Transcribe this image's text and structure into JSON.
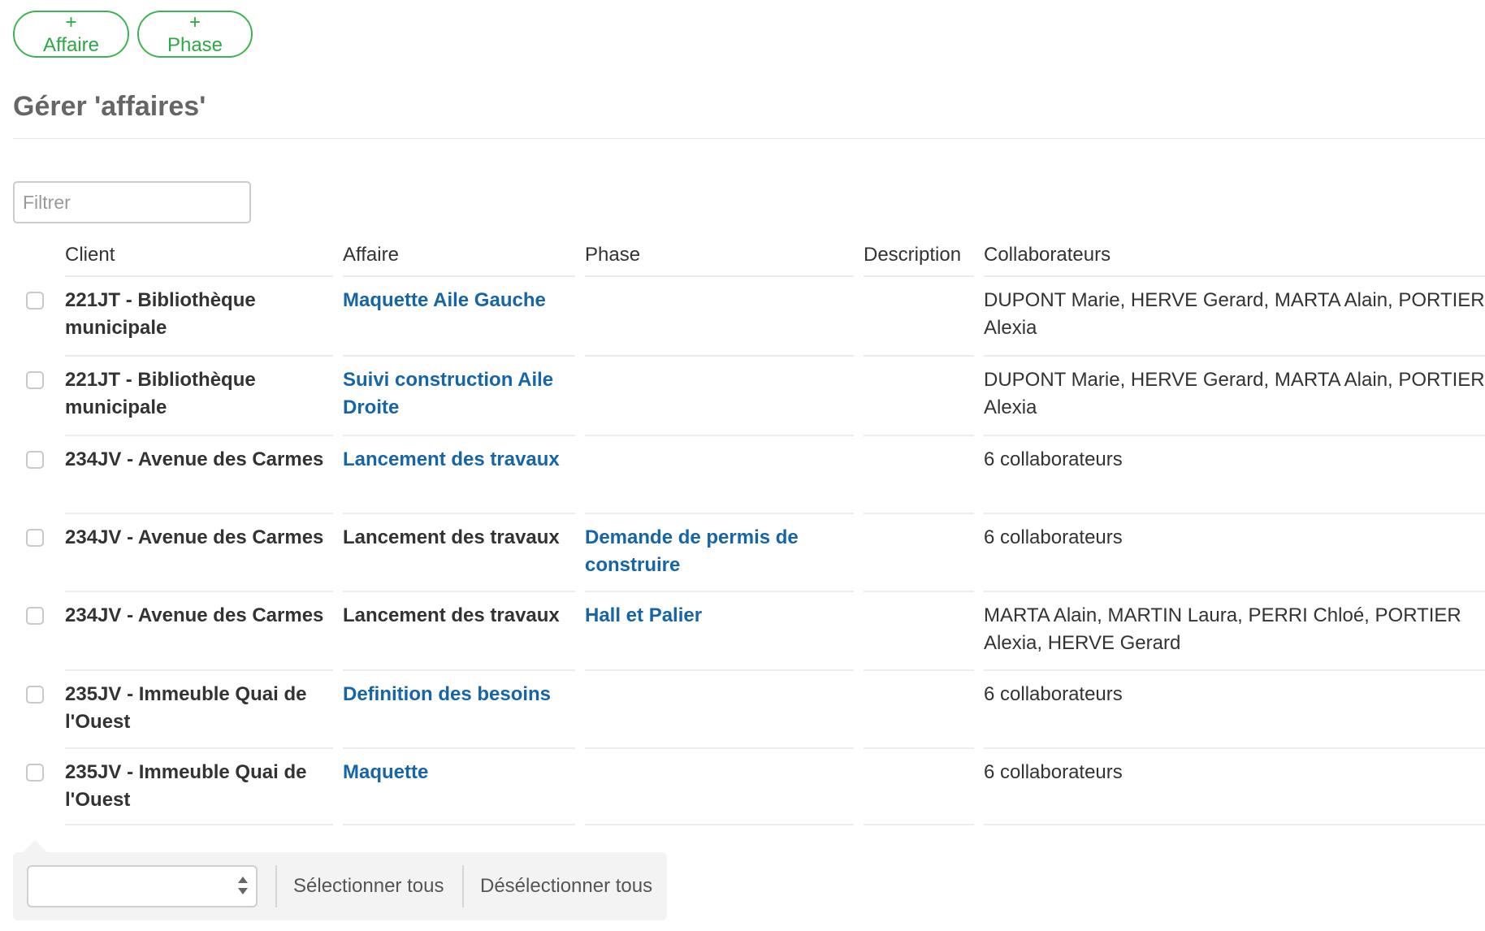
{
  "toolbar": {
    "add_affaire_label": "+ Affaire",
    "add_phase_label": "+ Phase"
  },
  "page": {
    "title": "Gérer 'affaires'"
  },
  "filter": {
    "placeholder": "Filtrer",
    "value": ""
  },
  "table": {
    "headers": {
      "client": "Client",
      "affaire": "Affaire",
      "phase": "Phase",
      "description": "Description",
      "collaborateurs": "Collaborateurs"
    },
    "rows": [
      {
        "client": "221JT - Bibliothèque municipale",
        "affaire": "Maquette Aile Gauche",
        "affaire_is_link": true,
        "phase": "",
        "description": "",
        "collaborateurs": "DUPONT Marie, HERVE Gerard, MARTA Alain, PORTIER Alexia"
      },
      {
        "client": "221JT - Bibliothèque municipale",
        "affaire": "Suivi construction Aile Droite",
        "affaire_is_link": true,
        "phase": "",
        "description": "",
        "collaborateurs": "DUPONT Marie, HERVE Gerard, MARTA Alain, PORTIER Alexia"
      },
      {
        "client": "234JV - Avenue des Carmes",
        "affaire": "Lancement des travaux",
        "affaire_is_link": true,
        "phase": "",
        "description": "",
        "collaborateurs": "6 collaborateurs"
      },
      {
        "client": "234JV - Avenue des Carmes",
        "affaire": "Lancement des travaux",
        "affaire_is_link": false,
        "phase": "Demande de permis de construire",
        "description": "",
        "collaborateurs": "6 collaborateurs"
      },
      {
        "client": "234JV - Avenue des Carmes",
        "affaire": "Lancement des travaux",
        "affaire_is_link": false,
        "phase": "Hall et Palier",
        "description": "",
        "collaborateurs": "MARTA Alain, MARTIN Laura, PERRI Chloé, PORTIER Alexia, HERVE Gerard"
      },
      {
        "client": "235JV - Immeuble Quai de l'Ouest",
        "affaire": "Definition des besoins",
        "affaire_is_link": true,
        "phase": "",
        "description": "",
        "collaborateurs": "6 collaborateurs"
      },
      {
        "client": "235JV - Immeuble Quai de l'Ouest",
        "affaire": "Maquette",
        "affaire_is_link": true,
        "phase": "",
        "description": "",
        "collaborateurs": "6 collaborateurs"
      }
    ]
  },
  "bulk": {
    "action_value": "",
    "select_all_label": "Sélectionner tous",
    "deselect_all_label": "Désélectionner tous"
  },
  "colors": {
    "accent_green": "#2ca844",
    "link_blue": "#1565a8",
    "title_gray": "#666666"
  }
}
